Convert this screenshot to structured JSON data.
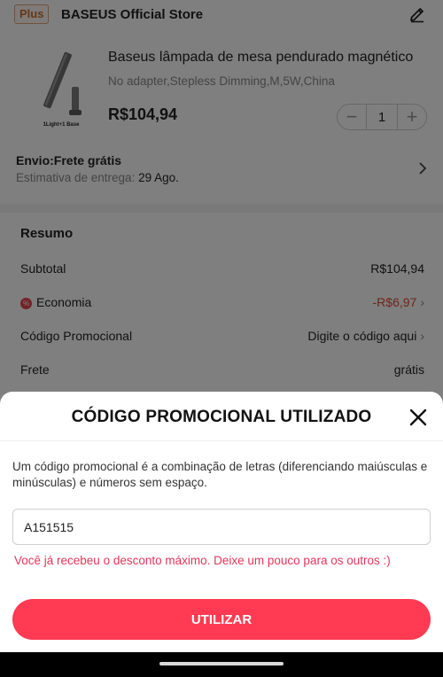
{
  "store": {
    "plus_label": "Plus",
    "name": "BASEUS Official Store"
  },
  "product": {
    "title": "Baseus lâmpada de mesa pendurado magnético",
    "variant": "No adapter,Stepless Dimming,M,5W,China",
    "image_caption": "1Light+1 Base",
    "price": "R$104,94",
    "quantity": "1",
    "minus": "−",
    "plus": "+"
  },
  "shipping": {
    "title": "Envio:Frete grátis",
    "estimate_label": "Estimativa de entrega:",
    "estimate_date": "29 Ago."
  },
  "summary": {
    "title": "Resumo",
    "subtotal_label": "Subtotal",
    "subtotal_value": "R$104,94",
    "economy_label": "Economia",
    "economy_value": "-R$6,97",
    "promo_label": "Código Promocional",
    "promo_value": "Digite o código aqui",
    "shipping_label": "Frete",
    "shipping_value": "grátis"
  },
  "promo_sheet": {
    "title": "CÓDIGO PROMOCIONAL UTILIZADO",
    "description": "Um código promocional é a combinação de letras (diferenciando maiúsculas e minúsculas) e números sem espaço.",
    "code_value": "A151515",
    "error": "Você já recebeu o desconto máximo. Deixe um pouco para os outros :)",
    "button_label": "UTILIZAR"
  },
  "colors": {
    "accent": "#ff3a52",
    "error_text": "#e5355a",
    "discount_text": "#e24a2f",
    "plus_badge": "#c9702c"
  },
  "icons": {
    "edit": "pencil-icon",
    "close": "close-icon",
    "chevron": "chevron-right-icon",
    "economy": "discount-badge-icon"
  }
}
